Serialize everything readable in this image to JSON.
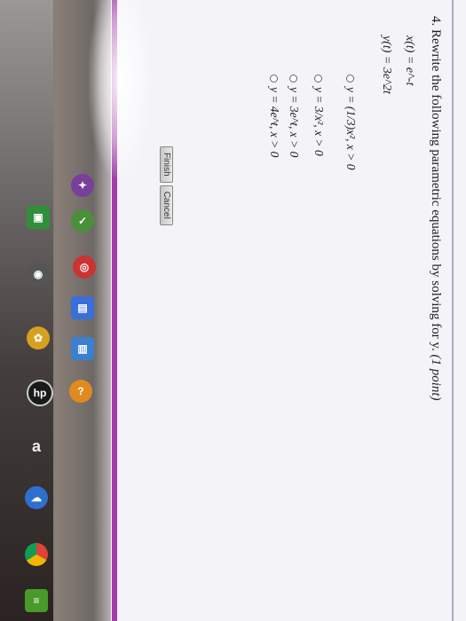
{
  "question": {
    "number": "4.",
    "text": "Rewrite the following parametric equations by solving for y.",
    "points": "(1 point)"
  },
  "equations": [
    "x(t) = e^-t",
    "y(t) = 3e^2t"
  ],
  "options": [
    "y = (1/3)x², x > 0",
    "y = 3/x², x > 0",
    "y = 3e^t, x > 0",
    "y = 4e^t, x > 0"
  ],
  "buttons": {
    "finish": "Finish",
    "cancel": "Cancel"
  },
  "taskbar_icons": [
    "game-icon",
    "windows-store-icon",
    "checklist-icon",
    "settings-icon",
    "photos-icon",
    "puzzle-icon",
    "hp-icon",
    "amazon-icon",
    "onedrive-icon",
    "chrome-icon",
    "menu-icon"
  ],
  "colors": {
    "accent_purple": "#a23ea9",
    "text": "#222222",
    "page_bg": "#f4f3f8"
  }
}
